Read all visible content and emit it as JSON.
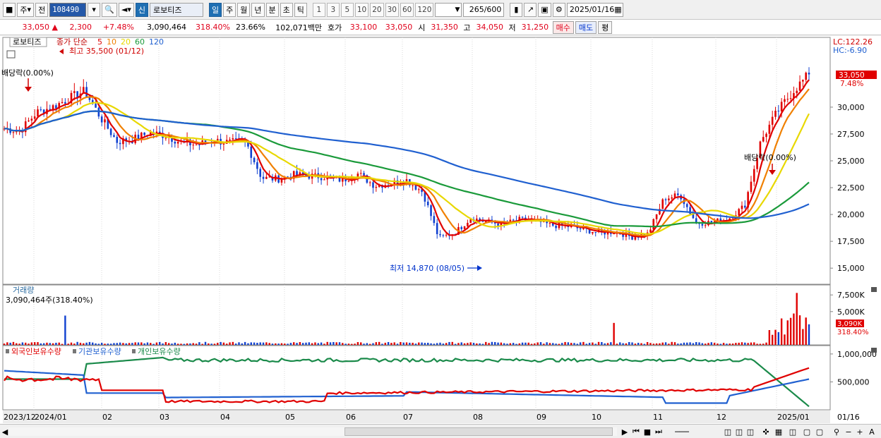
{
  "toolbar": {
    "mode1": "주",
    "mode2": "전",
    "code": "108490",
    "stock_tag": "신",
    "stock_name": "로보티즈",
    "periods": [
      "일",
      "주",
      "월",
      "년",
      "분",
      "초",
      "틱"
    ],
    "active_period": "일",
    "intervals": [
      "1",
      "3",
      "5",
      "10",
      "20",
      "30",
      "60",
      "120"
    ],
    "count": "265",
    "count_max": "/600",
    "date": "2025/01/16"
  },
  "quote": {
    "price": "33,050",
    "change": "2,300",
    "change_pct": "+7.48%",
    "volume": "3,090,464",
    "volume_ratio": "318.40%",
    "turnover": "23.66%",
    "amount": "102,071백만",
    "bid_label": "호가",
    "bid": "33,100",
    "ask": "33,050",
    "open_label": "시",
    "open": "31,350",
    "high_label": "고",
    "high": "34,050",
    "low_label": "저",
    "low": "31,250",
    "buy_label": "매수",
    "sell_label": "매도",
    "eval_label": "평"
  },
  "price_panel": {
    "stock_label": "로보티즈",
    "ma_title": "종가 단순",
    "ma_periods": [
      {
        "label": "5",
        "color": "#e00000"
      },
      {
        "label": "10",
        "color": "#f08000"
      },
      {
        "label": "20",
        "color": "#e8d800"
      },
      {
        "label": "60",
        "color": "#1a9a3a"
      },
      {
        "label": "120",
        "color": "#2060d0"
      }
    ],
    "lc": "LC:122.26",
    "hc": "HC:-6.90",
    "current_tag": "33,050",
    "current_pct": "7.48%",
    "high_note": "최고 35,500 (01/12)",
    "low_note": "최저 14,870 (08/05)",
    "dividend_note_1": "배당락(0.00%)",
    "dividend_note_2": "배당락(0.00%)",
    "y_ticks": [
      "30,000",
      "27,500",
      "25,000",
      "22,500",
      "20,000",
      "17,500",
      "15,000"
    ]
  },
  "volume_panel": {
    "title": "거래량",
    "value": "3,090,464주(318.40%)",
    "y_ticks": [
      "7,500K",
      "5,000K"
    ],
    "current_tag": "3,090K",
    "current_pct": "318.40%"
  },
  "holding_panel": {
    "series": [
      {
        "label": "외국인보유수량",
        "color": "#e00000"
      },
      {
        "label": "기관보유수량",
        "color": "#2060d0"
      },
      {
        "label": "개인보유수량",
        "color": "#1a8a4a"
      }
    ],
    "y_ticks": [
      "1,000,000",
      "500,000"
    ]
  },
  "x_axis": {
    "labels": [
      "2023/12",
      "2024/01",
      "02",
      "03",
      "04",
      "05",
      "06",
      "07",
      "08",
      "09",
      "10",
      "11",
      "12",
      "2025/01"
    ],
    "right_label": "01/16"
  },
  "chart_data": {
    "type": "line",
    "price_series": {
      "x": [
        0.0,
        0.02,
        0.04,
        0.06,
        0.08,
        0.1,
        0.12,
        0.14,
        0.16,
        0.18,
        0.2,
        0.22,
        0.24,
        0.26,
        0.28,
        0.3,
        0.32,
        0.34,
        0.36,
        0.38,
        0.4,
        0.42,
        0.44,
        0.46,
        0.48,
        0.5,
        0.52,
        0.54,
        0.56,
        0.58,
        0.6,
        0.62,
        0.64,
        0.66,
        0.68,
        0.7,
        0.72,
        0.74,
        0.76,
        0.78,
        0.8,
        0.82,
        0.84,
        0.86,
        0.88,
        0.9,
        0.92,
        0.94,
        0.96,
        0.98,
        1.0
      ],
      "close": [
        28000,
        27800,
        29500,
        30000,
        30800,
        31500,
        29000,
        26800,
        27000,
        27600,
        27400,
        26700,
        26500,
        26900,
        26700,
        26800,
        23400,
        23300,
        23700,
        23600,
        23500,
        23200,
        23800,
        22700,
        22900,
        23200,
        22100,
        17800,
        18300,
        19700,
        19300,
        19100,
        19500,
        19400,
        19000,
        18900,
        18600,
        18300,
        18400,
        17900,
        18200,
        21500,
        21800,
        19200,
        19300,
        19600,
        20800,
        26800,
        29500,
        31500,
        33050
      ]
    },
    "volume_y_ticks": [
      7500000,
      5000000
    ],
    "holding_y_ticks": [
      1000000,
      500000
    ]
  }
}
